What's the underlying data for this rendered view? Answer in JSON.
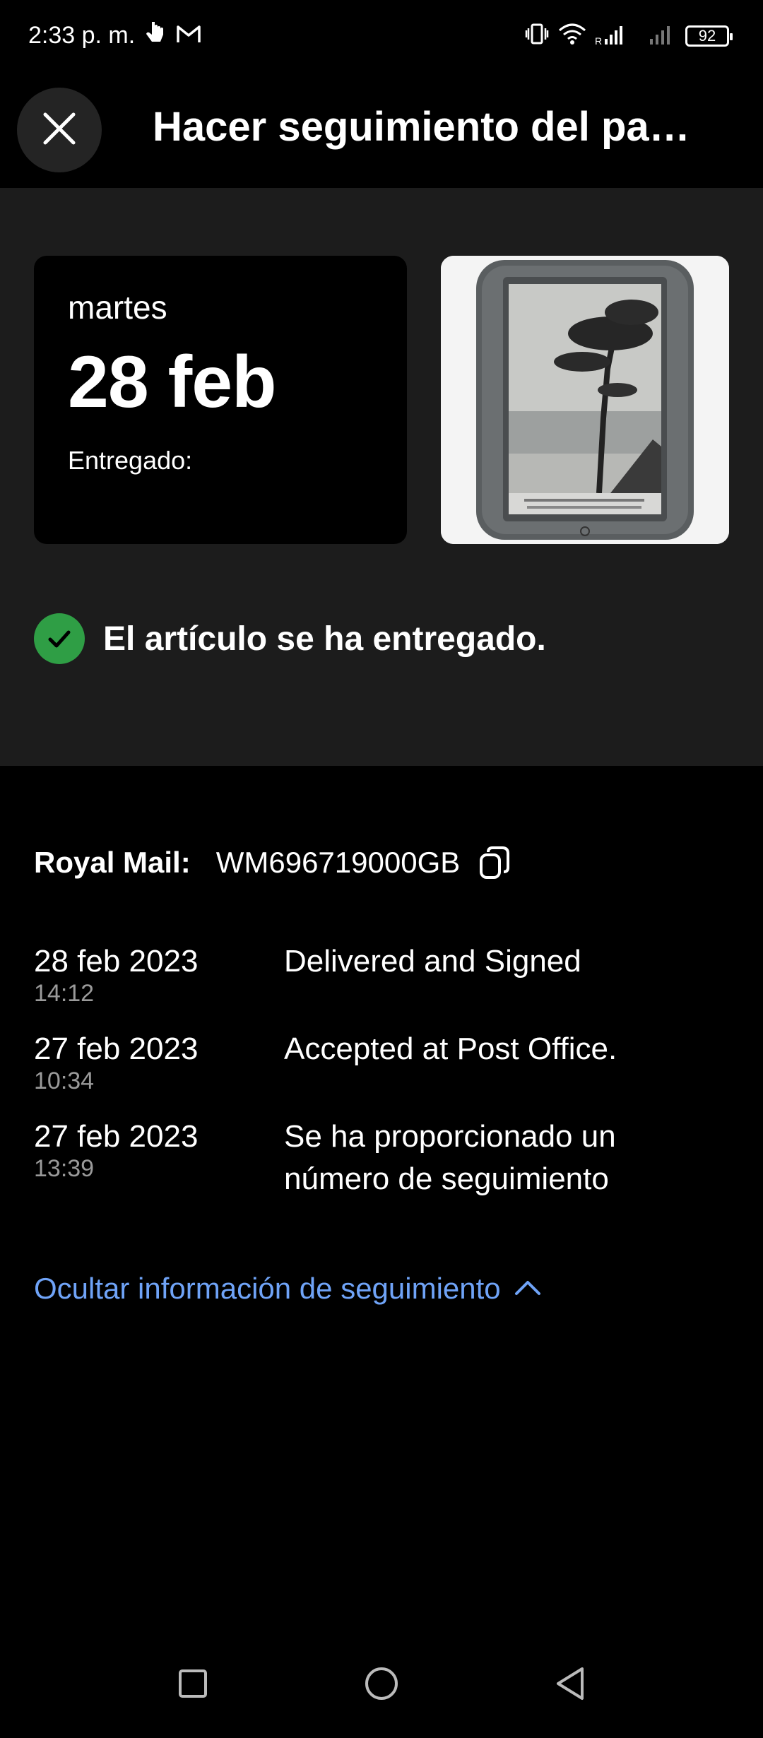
{
  "status_bar": {
    "time": "2:33 p. m.",
    "battery": "92",
    "network": "R"
  },
  "header": {
    "title": "Hacer seguimiento del pa…"
  },
  "summary": {
    "weekday": "martes",
    "date": "28 feb",
    "status_label": "Entregado:",
    "delivered_message": "El artículo se ha entregado."
  },
  "tracking": {
    "carrier_label": "Royal Mail:",
    "tracking_number": "WM696719000GB",
    "events": [
      {
        "date": "28 feb 2023",
        "time": "14:12",
        "description": "Delivered and Signed"
      },
      {
        "date": "27 feb 2023",
        "time": "10:34",
        "description": "Accepted at Post Office."
      },
      {
        "date": "27 feb 2023",
        "time": "13:39",
        "description": "Se ha proporcionado un número de seguimiento"
      }
    ],
    "toggle_label": "Ocultar información de seguimiento"
  },
  "colors": {
    "accent_link": "#6fa3f7",
    "success": "#2f9e45",
    "panel_bg": "#1c1c1c",
    "background": "#000000"
  },
  "icons": {
    "close": "close-icon",
    "check": "check-circle-icon",
    "copy": "copy-icon",
    "chevron": "chevron-up-icon",
    "nav_recent": "square-icon",
    "nav_home": "circle-icon",
    "nav_back": "triangle-back-icon"
  }
}
